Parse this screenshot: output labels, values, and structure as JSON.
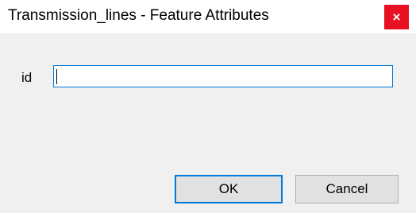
{
  "window": {
    "title": "Transmission_lines - Feature Attributes",
    "close_glyph": "×"
  },
  "form": {
    "id_label": "id",
    "id_value": ""
  },
  "buttons": {
    "ok_label": "OK",
    "cancel_label": "Cancel"
  },
  "colors": {
    "close_button_bg": "#e81123",
    "focus_border": "#0078d7",
    "dialog_bg": "#f0f0f0"
  }
}
